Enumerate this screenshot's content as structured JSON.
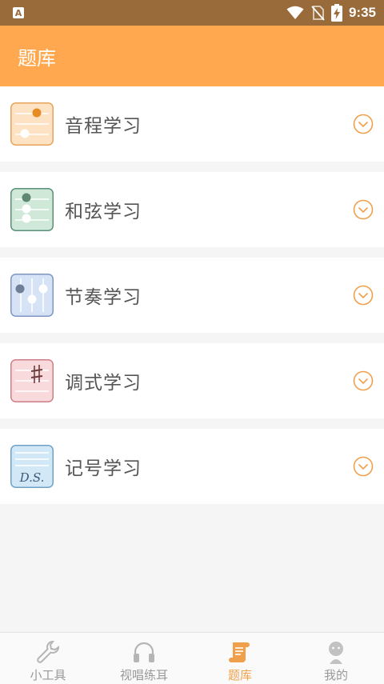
{
  "status_bar": {
    "notification_icon": "A",
    "time": "9:35",
    "icons": [
      "wifi-icon",
      "no-sim-icon",
      "battery-charging-icon"
    ]
  },
  "app_bar": {
    "title": "题库"
  },
  "categories": [
    {
      "label": "音程学习",
      "icon": "interval-icon",
      "icon_color": "#fde3c4"
    },
    {
      "label": "和弦学习",
      "icon": "chord-icon",
      "icon_color": "#cfe8d8"
    },
    {
      "label": "节奏学习",
      "icon": "rhythm-icon",
      "icon_color": "#d6e2f5"
    },
    {
      "label": "调式学习",
      "icon": "mode-icon",
      "icon_color": "#f8dadc"
    },
    {
      "label": "记号学习",
      "icon": "notation-icon",
      "icon_color": "#d3e8f6",
      "icon_text": "D.S."
    }
  ],
  "tab_bar": {
    "tabs": [
      {
        "label": "小工具",
        "icon": "wrench-icon",
        "active": false
      },
      {
        "label": "视唱练耳",
        "icon": "headphones-icon",
        "active": false
      },
      {
        "label": "题库",
        "icon": "scroll-icon",
        "active": true
      },
      {
        "label": "我的",
        "icon": "person-icon",
        "active": false
      }
    ]
  },
  "colors": {
    "accent": "#ffa84f",
    "status_bar": "#9a6b3a",
    "active_tab": "#f0a04b",
    "chevron": "#f0a04b"
  }
}
